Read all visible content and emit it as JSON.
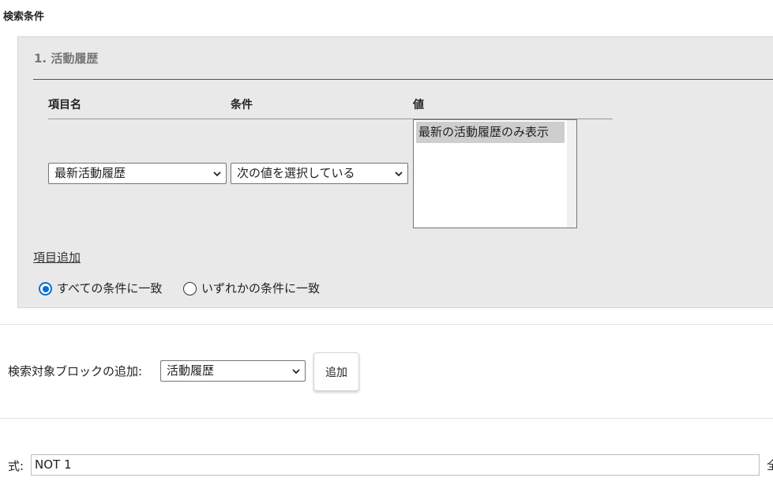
{
  "page": {
    "title": "検索条件"
  },
  "block": {
    "title": "1. 活動履歴",
    "headers": {
      "item": "項目名",
      "condition": "条件",
      "value": "値"
    },
    "row": {
      "item_select": "最新活動履歴",
      "condition_select": "次の値を選択している",
      "value_options": [
        "最新の活動履歴のみ表示"
      ]
    },
    "add_item_link": "項目追加",
    "match": {
      "all_label": "すべての条件に一致",
      "any_label": "いずれかの条件に一致",
      "selected": "all"
    }
  },
  "add_block": {
    "label": "検索対象ブロックの追加:",
    "select": "活動履歴",
    "button": "追加"
  },
  "formula": {
    "label": "式:",
    "value": "NOT 1",
    "trailing_text": "全"
  },
  "colors": {
    "radio_accent": "#0a6ed1",
    "block_bg": "#e9e9e9"
  }
}
